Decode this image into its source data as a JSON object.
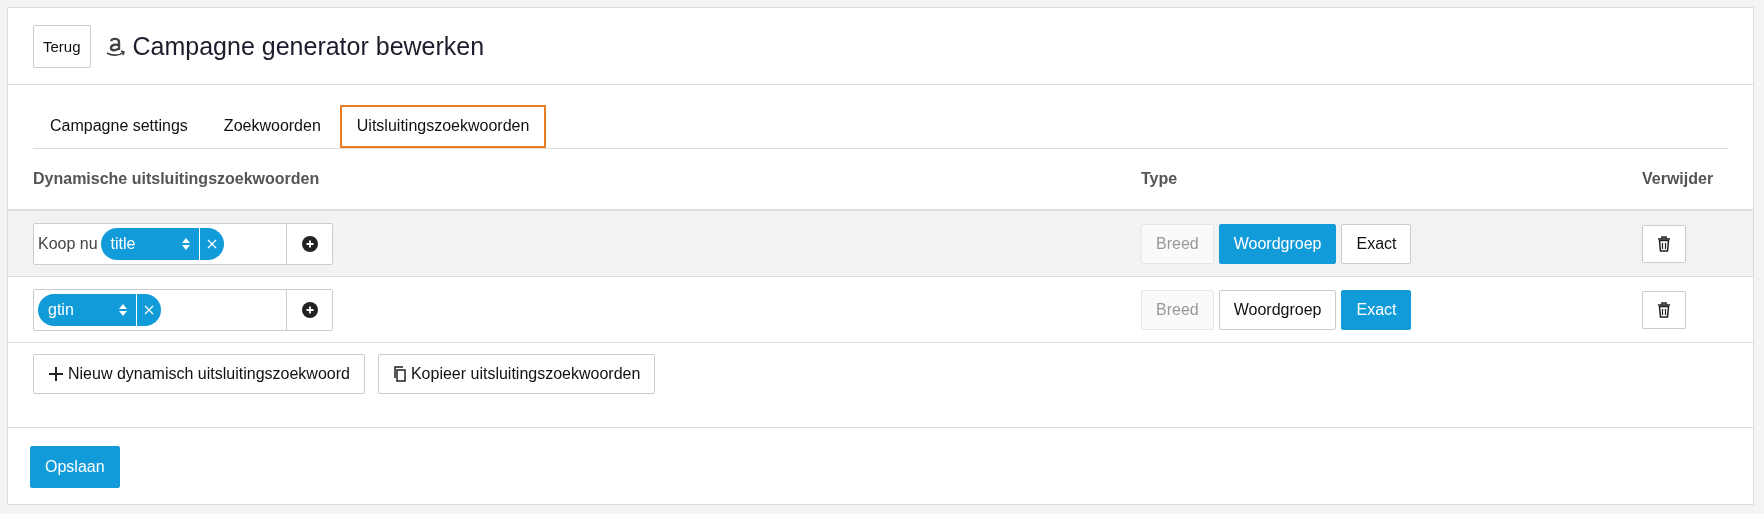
{
  "header": {
    "back_button": "Terug",
    "title": "Campagne generator bewerken"
  },
  "tabs": [
    {
      "label": "Campagne settings",
      "selected": false
    },
    {
      "label": "Zoekwoorden",
      "selected": false
    },
    {
      "label": "Uitsluitingszoekwoorden",
      "selected": true
    }
  ],
  "table": {
    "columns": [
      "Dynamische uitsluitingszoekwoorden",
      "Type",
      "Verwijder"
    ],
    "rows": [
      {
        "highlighted": true,
        "prefix": "Koop nu",
        "tag": "title",
        "types": [
          {
            "label": "Breed",
            "selected": false,
            "disabled": true
          },
          {
            "label": "Woordgroep",
            "selected": true,
            "disabled": false
          },
          {
            "label": "Exact",
            "selected": false,
            "disabled": false
          }
        ]
      },
      {
        "highlighted": false,
        "tag": "gtin",
        "types": [
          {
            "label": "Breed",
            "selected": false,
            "disabled": true
          },
          {
            "label": "Woordgroep",
            "selected": false,
            "disabled": false
          },
          {
            "label": "Exact",
            "selected": true,
            "disabled": false
          }
        ]
      }
    ]
  },
  "actions": [
    {
      "kind": "add",
      "label": "Nieuw dynamisch uitsluitingszoekwoord"
    },
    {
      "kind": "copy",
      "label": "Kopieer uitsluitingszoekwoorden"
    }
  ],
  "save_button": "Opslaan"
}
